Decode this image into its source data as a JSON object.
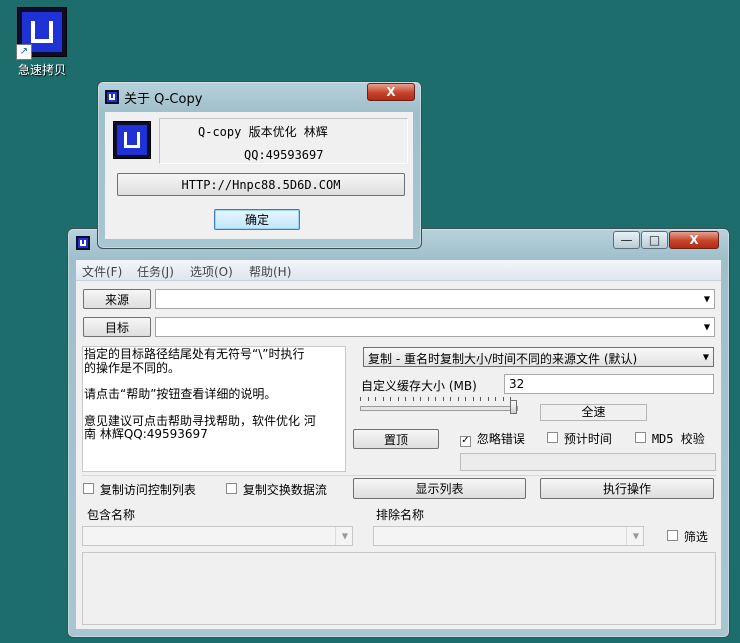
{
  "desktop": {
    "icon_label": "急速拷贝",
    "shortcut_glyph": "↗"
  },
  "about": {
    "title": "关于 Q-Copy",
    "line1": "Q-copy 版本优化 林辉",
    "line2": "QQ:49593697",
    "link": "HTTP://Hnpc88.5D6D.COM",
    "ok": "确定",
    "close_glyph": "X"
  },
  "main": {
    "controls": {
      "min": "—",
      "max": "□",
      "close": "X"
    },
    "menu": [
      "文件(F)",
      "任务(J)",
      "选项(O)",
      "帮助(H)"
    ],
    "source_btn": "来源",
    "target_btn": "目标",
    "source_value": "",
    "target_value": "",
    "info_lines": [
      "指定的目标路径结尾处有无符号“\\”时执行",
      "的操作是不同的。",
      "",
      "请点击“帮助”按钮查看详细的说明。",
      "",
      "意见建议可点击帮助寻找帮助，软件优化 河",
      "南 林辉QQ:49593697"
    ],
    "copy_mode": "复制 - 重名时复制大小/时间不同的来源文件 (默认)",
    "buffer_label": "自定义缓存大小 (MB)",
    "buffer_value": "32",
    "speed_label": "全速",
    "speed_level": 1.0,
    "top_btn": "置顶",
    "ignore_errors": {
      "label": "忽略错误",
      "checked": true
    },
    "estimate_time": {
      "label": "预计时间",
      "checked": false
    },
    "md5_check": {
      "label": "MD5 校验",
      "checked": false
    },
    "copy_acl": {
      "label": "复制访问控制列表",
      "checked": false
    },
    "copy_streams": {
      "label": "复制交换数据流",
      "checked": false
    },
    "show_list_btn": "显示列表",
    "execute_btn": "执行操作",
    "include_label": "包含名称",
    "exclude_label": "排除名称",
    "filter": {
      "label": "筛选",
      "checked": false
    }
  },
  "colors": {
    "desktop": "#1d6d6d",
    "accent": "#1e32d6"
  }
}
